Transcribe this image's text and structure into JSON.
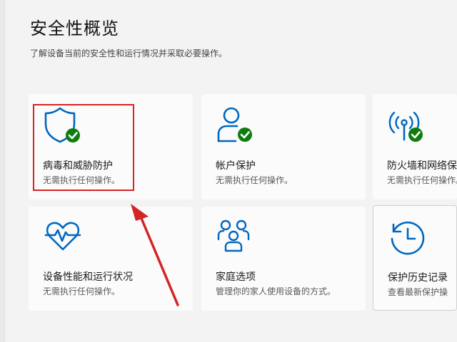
{
  "header": {
    "title": "安全性概览",
    "subtitle": "了解设备当前的安全性和运行情况并采取必要操作。"
  },
  "tiles": [
    {
      "title": "病毒和威胁防护",
      "status": "无需执行任何操作。",
      "icon": "shield-check-icon"
    },
    {
      "title": "帐户保护",
      "status": "无需执行任何操作。",
      "icon": "user-check-icon"
    },
    {
      "title": "防火墙和网络保",
      "status": "无需执行任何操作。",
      "icon": "antenna-check-icon"
    },
    {
      "title": "设备性能和运行状况",
      "status": "无需执行任何操作。",
      "icon": "heart-pulse-icon"
    },
    {
      "title": "家庭选项",
      "status": "管理你的家人使用设备的方式。",
      "icon": "family-icon"
    },
    {
      "title": "保护历史记录",
      "status": "查看最新保护操",
      "icon": "history-icon"
    }
  ],
  "colors": {
    "icon_blue": "#0067c0",
    "check_green": "#107c10",
    "highlight_red": "#d42424"
  }
}
